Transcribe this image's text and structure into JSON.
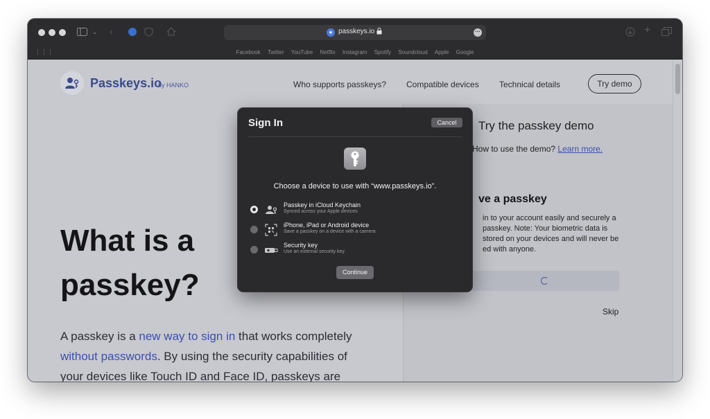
{
  "browser": {
    "url": "passkeys.io",
    "favorites": [
      "Facebook",
      "Twitter",
      "YouTube",
      "Netflix",
      "Instagram",
      "Spotify",
      "Soundcloud",
      "Apple",
      "Google"
    ]
  },
  "site": {
    "logo_text": "Passkeys.io",
    "logo_by": "by HANKO",
    "nav": [
      "Who supports passkeys?",
      "Compatible devices",
      "Technical details"
    ],
    "cta": "Try demo",
    "hero_line1": "What is a",
    "hero_line2": "passkey?",
    "para_a": "A passkey is a ",
    "para_link1": "new way to sign in",
    "para_b": " that works completely ",
    "para_link2": "without passwords",
    "para_c": ". By using the security capabilities of your devices like Touch ID and Face ID, passkeys are",
    "demo_title": "Try the passkey demo",
    "demo_how": "How to use the demo?",
    "demo_learn": "Learn more.",
    "save_title": "ve a passkey",
    "save_body": "in to your account easily and securely a passkey. Note: Your biometric data is stored on your devices and will never be ed with anyone.",
    "skip": "Skip"
  },
  "dialog": {
    "title": "Sign In",
    "cancel": "Cancel",
    "prompt": "Choose a device to use with “www.passkeys.io”.",
    "options": [
      {
        "title": "Passkey in iCloud Keychain",
        "subtitle": "Synced across your Apple devices",
        "icon": "icloud-keychain-person-icon",
        "selected": true
      },
      {
        "title": "iPhone, iPad or Android device",
        "subtitle": "Save a passkey on a device with a camera",
        "icon": "qr-code-icon",
        "selected": false
      },
      {
        "title": "Security key",
        "subtitle": "Use an external security key",
        "icon": "security-key-icon",
        "selected": false
      }
    ],
    "continue": "Continue"
  }
}
